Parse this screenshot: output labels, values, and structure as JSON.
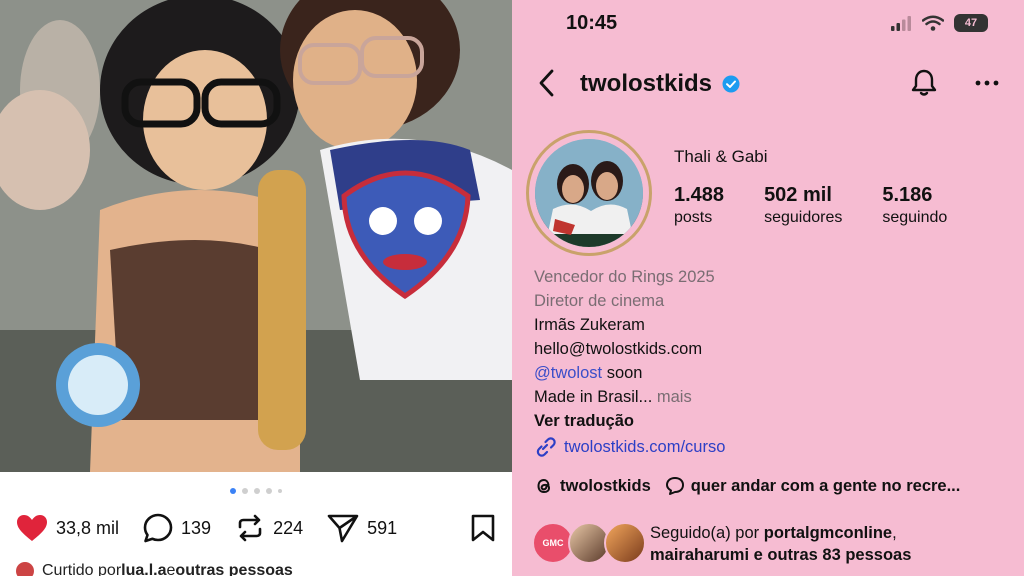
{
  "post": {
    "carousel": {
      "count": 5,
      "active_index": 0
    },
    "likes": "33,8 mil",
    "comments": "139",
    "reposts": "224",
    "shares": "591",
    "liked_by_prefix": "Curtido por ",
    "liked_by_user": "lua.l.a",
    "liked_by_mid": " e ",
    "liked_by_others": "outras pessoas"
  },
  "status_bar": {
    "time": "10:45",
    "battery": "47"
  },
  "profile": {
    "username": "twolostkids",
    "verified": true,
    "display_name": "Thali & Gabi",
    "stats": [
      {
        "value": "1.488",
        "label": "posts"
      },
      {
        "value": "502 mil",
        "label": "seguidores"
      },
      {
        "value": "5.186",
        "label": "seguindo"
      }
    ],
    "bio": {
      "category_1": "Vencedor do Rings 2025",
      "category_2": "Diretor de cinema",
      "line_1": "Irmãs Zukeram",
      "line_2": "hello@twolostkids.com",
      "mention": "@twolost",
      "mention_suffix": " soon",
      "line_4": "Made in Brasil...",
      "more": " mais",
      "translate": "Ver tradução",
      "link": "twolostkids.com/curso"
    },
    "threads_handle": "twolostkids",
    "threads_note": "quer andar com a gente no recre...",
    "followed_by": {
      "badge": "GMC",
      "prefix": "Seguido(a) por ",
      "user_1": "portalgmconline",
      "comma": ",",
      "user_2": "mairaharumi",
      "suffix": " e outras 83 pessoas"
    }
  },
  "colors": {
    "profile_bg": "#f6bcd2",
    "heart": "#e0243b",
    "link": "#2c3fc6",
    "verified": "#1d9bf0",
    "carousel_active": "#3b82f6"
  }
}
